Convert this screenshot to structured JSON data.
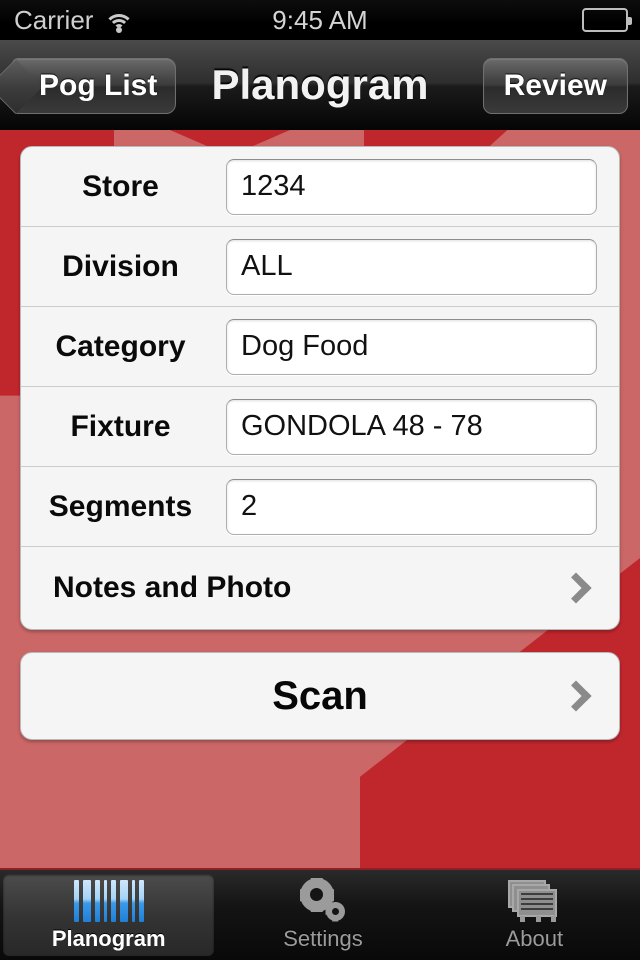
{
  "status_bar": {
    "carrier": "Carrier",
    "time": "9:45 AM",
    "wifi_icon": "wifi-icon",
    "battery_icon": "battery-icon"
  },
  "nav_bar": {
    "back_label": "Pog List",
    "title": "Planogram",
    "right_label": "Review"
  },
  "form": {
    "rows": [
      {
        "label": "Store",
        "value": "1234"
      },
      {
        "label": "Division",
        "value": "ALL"
      },
      {
        "label": "Category",
        "value": "Dog Food"
      },
      {
        "label": "Fixture",
        "value": "GONDOLA 48 - 78"
      },
      {
        "label": "Segments",
        "value": "2"
      }
    ],
    "notes_row": {
      "label": "Notes and Photo",
      "chevron_icon": "chevron-right-icon"
    }
  },
  "scan_button": {
    "label": "Scan",
    "chevron_icon": "chevron-right-icon"
  },
  "tab_bar": {
    "tabs": [
      {
        "label": "Planogram",
        "icon": "barcode-icon",
        "selected": true
      },
      {
        "label": "Settings",
        "icon": "gear-icon",
        "selected": false
      },
      {
        "label": "About",
        "icon": "shelf-icon",
        "selected": false
      }
    ]
  },
  "colors": {
    "background_dark_red": "#C0272D",
    "background_light_red": "#CC6767",
    "card_background": "#F5F5F5",
    "nav_bar_dark": "#2E2E2E",
    "tab_selected_text": "#FFFFFF",
    "tab_text": "#9B9B9B",
    "barcode_blue": "#1F7FD6"
  }
}
